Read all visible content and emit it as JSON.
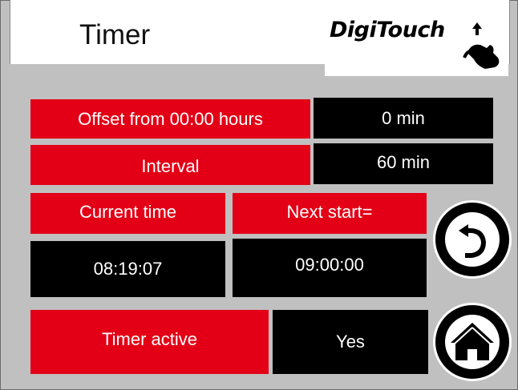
{
  "header": {
    "title": "Timer",
    "logo_text": "DigiTouch"
  },
  "rows": {
    "offset": {
      "label": "Offset from 00:00 hours",
      "value": "0 min"
    },
    "interval": {
      "label": "Interval",
      "value": "60 min"
    },
    "current_time": {
      "label": "Current time",
      "value": "08:19:07"
    },
    "next_start": {
      "label": "Next start=",
      "value": "09:00:00"
    },
    "timer_active": {
      "label": "Timer active",
      "value": "Yes"
    }
  },
  "buttons": {
    "back_icon": "undo-arrow-icon",
    "home_icon": "home-icon"
  },
  "colors": {
    "accent_red": "#e30016",
    "value_bg": "#000000",
    "panel_bg": "#c0c0c0"
  }
}
